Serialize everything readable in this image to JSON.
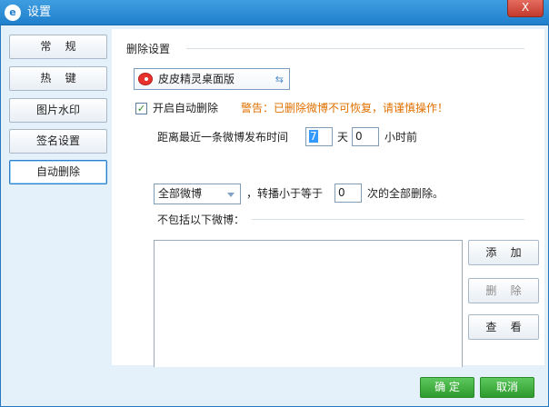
{
  "window": {
    "title": "设置",
    "close_label": "X"
  },
  "sidebar": {
    "items": [
      {
        "label": "常    规"
      },
      {
        "label": "热    键"
      },
      {
        "label": "图片水印"
      },
      {
        "label": "签名设置"
      },
      {
        "label": "自动删除"
      }
    ],
    "active": "自动删除"
  },
  "delete_settings": {
    "section_title": "删除设置",
    "account": "皮皮精灵桌面版",
    "enable_label": "开启自动删除",
    "enable_checked": true,
    "warning": "警告：已删除微博不可恢复，请谨慎操作！",
    "time_prefix": "距离最近一条微博发布时间",
    "days_value": "7",
    "days_unit": "天",
    "hours_value": "0",
    "hours_unit": "小时前",
    "type_selected": "全部微博",
    "repost_prefix": "，转播小于等于",
    "repost_value": "0",
    "repost_suffix": "次的全部删除。",
    "exclude_label": "不包括以下微博："
  },
  "side_buttons": {
    "add": "添    加",
    "delete": "删    除",
    "view": "查    看"
  },
  "footer": {
    "ok": "确 定",
    "cancel": "取消"
  },
  "colors": {
    "title_bar": "#1f7fcc",
    "warning": "#e07000",
    "primary_button": "#2e9a2e"
  }
}
